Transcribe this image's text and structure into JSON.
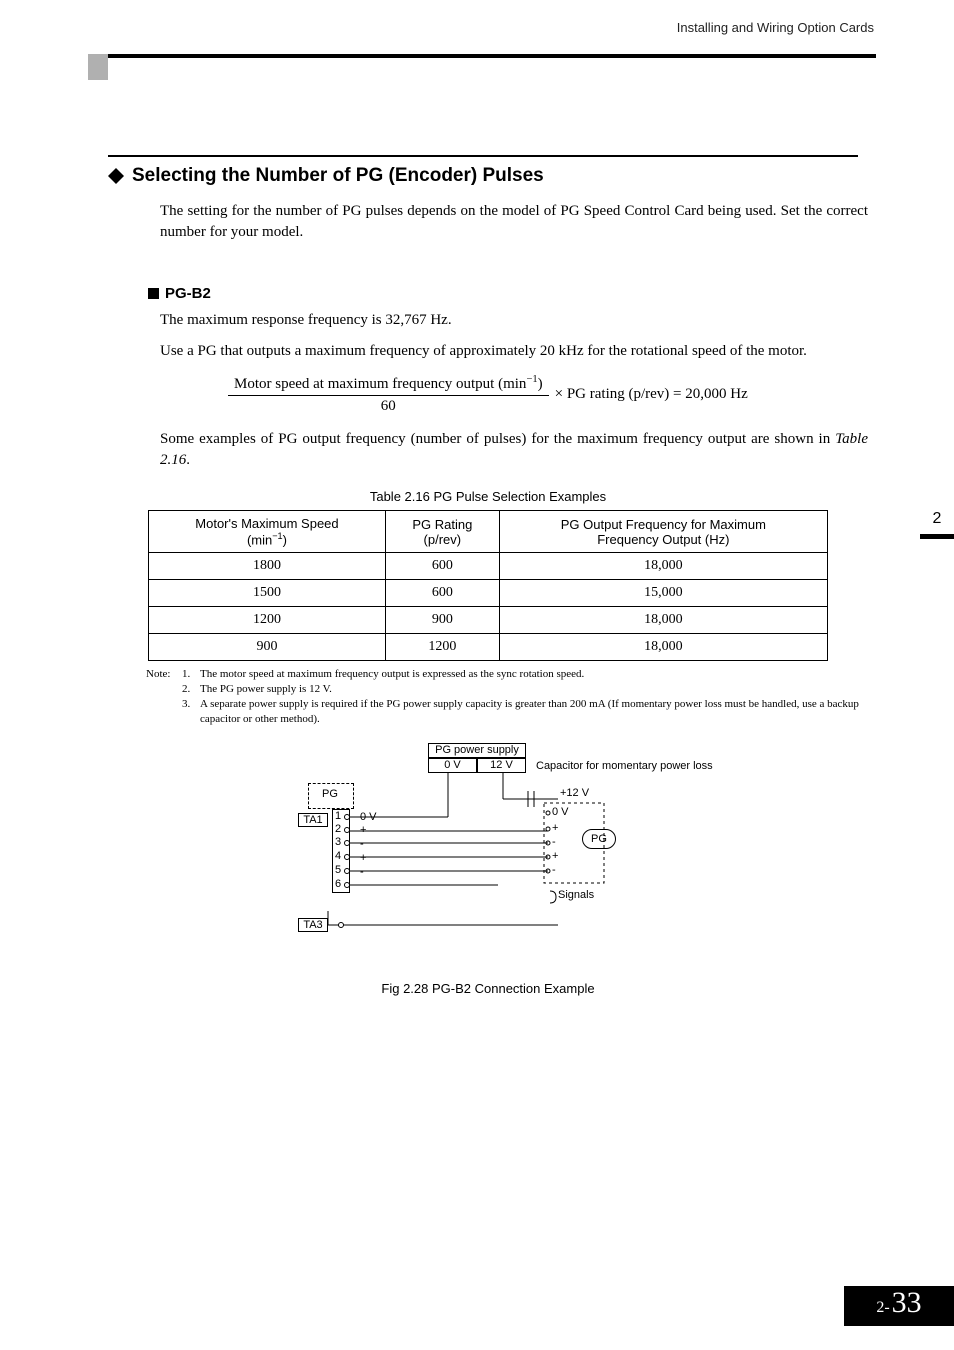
{
  "header": {
    "running_head": "Installing and Wiring Option Cards"
  },
  "section": {
    "title": "Selecting the Number of PG (Encoder) Pulses",
    "intro": "The setting for the number of PG pulses depends on the model of PG Speed Control Card being used. Set the correct number for your model."
  },
  "subsection": {
    "heading": "PG-B2",
    "p1": "The maximum response frequency is 32,767 Hz.",
    "p2": "Use a PG that outputs a maximum frequency of approximately 20 kHz for the rotational speed of the motor.",
    "formula": {
      "numerator_prefix": "Motor speed at maximum frequency output (min",
      "numerator_exp": "−1",
      "numerator_suffix": ")",
      "denominator": "60",
      "tail": " × PG rating (p/rev) = 20,000 Hz"
    },
    "p3_a": "Some examples of PG output frequency (number of pulses) for the maximum frequency output are shown in ",
    "p3_ref": "Table 2.16",
    "p3_b": "."
  },
  "table": {
    "caption": "Table 2.16  PG Pulse Selection Examples",
    "headers": {
      "c1_a": "Motor's Maximum Speed",
      "c1_b_prefix": "(min",
      "c1_b_exp": "−1",
      "c1_b_suffix": ")",
      "c2_a": "PG Rating",
      "c2_b": "(p/rev)",
      "c3_a": "PG Output Frequency for Maximum",
      "c3_b": "Frequency Output (Hz)"
    },
    "rows": [
      {
        "speed": "1800",
        "rating": "600",
        "freq": "18,000"
      },
      {
        "speed": "1500",
        "rating": "600",
        "freq": "15,000"
      },
      {
        "speed": "1200",
        "rating": "900",
        "freq": "18,000"
      },
      {
        "speed": "900",
        "rating": "1200",
        "freq": "18,000"
      }
    ]
  },
  "notes": {
    "prefix": "Note:",
    "items": [
      "The motor speed at maximum frequency output is expressed as the sync rotation speed.",
      "The PG power supply is 12 V.",
      "A separate power supply is required if the PG power supply capacity is greater than 200 mA (If momentary power loss must be handled, use a backup capacitor or other method)."
    ]
  },
  "figure": {
    "labels": {
      "pg_supply": "PG power supply",
      "zero_v": "0 V",
      "twelve_v": "12 V",
      "plus_twelve": "+12 V",
      "cap": "Capacitor for momentary power loss",
      "pg_left": "PG",
      "ta1": "TA1",
      "ta3": "TA3",
      "pg_right": "PG",
      "signals": "Signals",
      "t1": "1",
      "t2": "2",
      "t3": "3",
      "t4": "4",
      "t5": "5",
      "t6": "6",
      "zv": "0 V",
      "plus": "+",
      "minus": "-"
    },
    "caption": "Fig 2.28  PG-B2 Connection Example"
  },
  "sidetab": {
    "chapter": "2"
  },
  "footer": {
    "prefix": "2-",
    "page": "33"
  }
}
